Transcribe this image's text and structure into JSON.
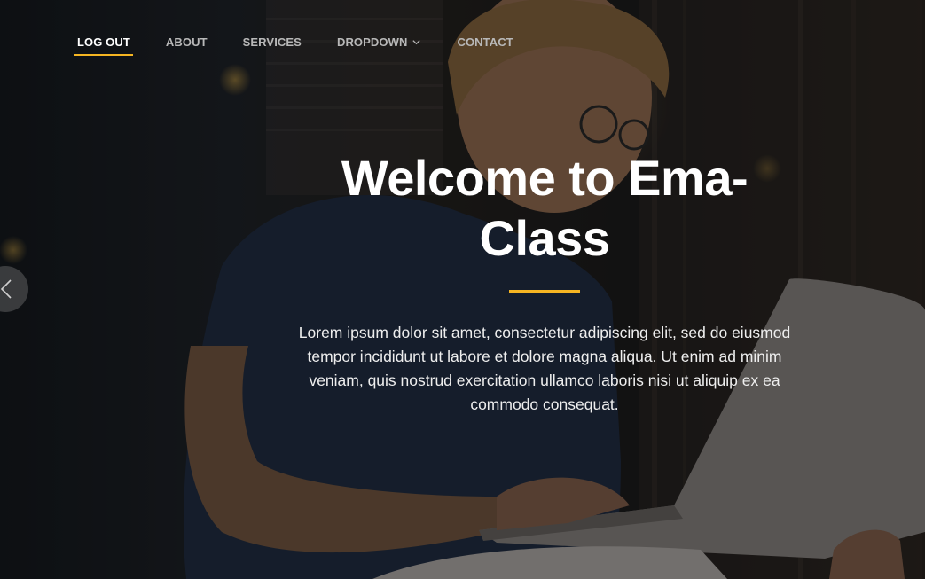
{
  "nav": {
    "items": [
      {
        "label": "LOG OUT"
      },
      {
        "label": "ABOUT"
      },
      {
        "label": "SERVICES"
      },
      {
        "label": "DROPDOWN"
      },
      {
        "label": "CONTACT"
      }
    ]
  },
  "hero": {
    "title_line1": "Welcome to Ema-",
    "title_line2": "Class",
    "description": "Lorem ipsum dolor sit amet, consectetur adipiscing elit, sed do eiusmod tempor incididunt ut labore et dolore magna aliqua. Ut enim ad minim veniam, quis nostrud exercitation ullamco laboris nisi ut aliquip ex ea commodo consequat."
  },
  "colors": {
    "accent": "#f5b522",
    "nav_active": "#ffffff",
    "nav_inactive": "#b8b8b8"
  },
  "icons": {
    "prev": "chevron-left-icon",
    "dropdown": "chevron-down-icon"
  }
}
